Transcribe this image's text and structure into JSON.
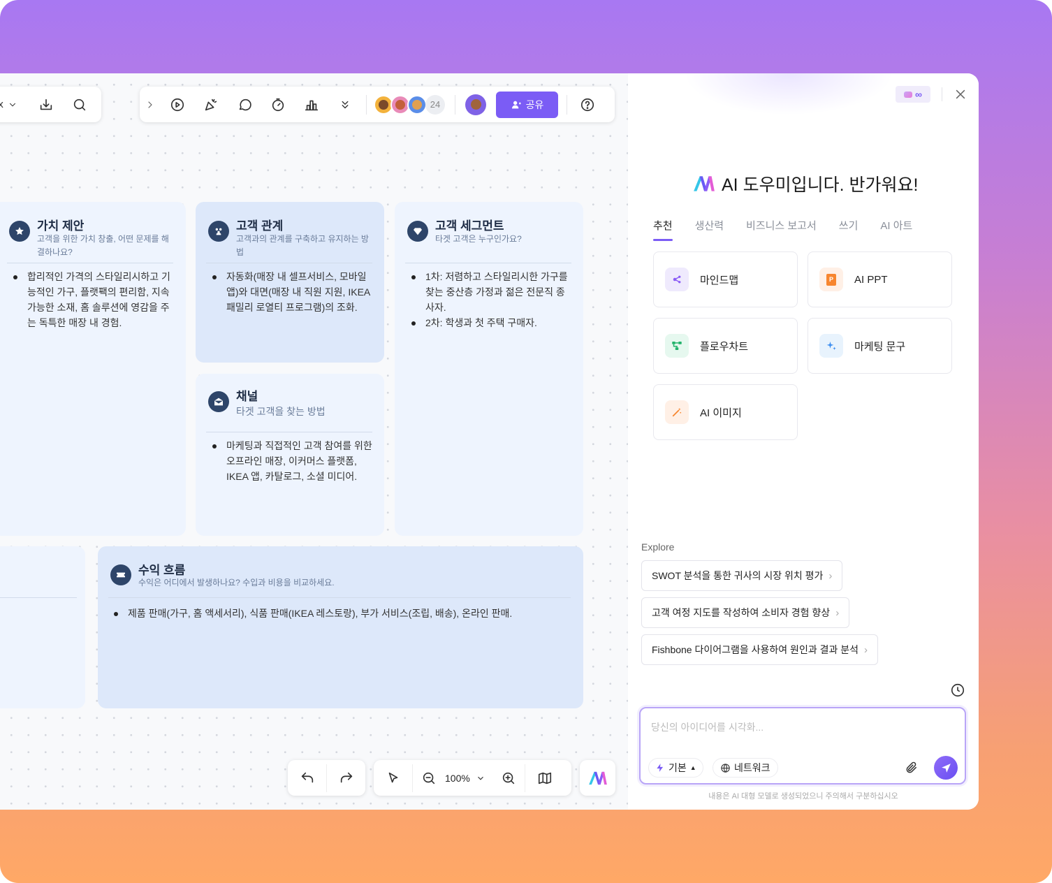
{
  "toolbar": {
    "zoom_label": "100%",
    "share_label": "공유",
    "collaborator_count": "24",
    "x_partial": "x"
  },
  "cards": {
    "value": {
      "title": "가치 제안",
      "sub": "고객을 위한 가치 창출, 어떤 문제를 해결하나요?",
      "items": [
        "합리적인 가격의 스타일리시하고 기능적인 가구, 플랫팩의 편리함, 지속 가능한 소재, 홈 솔루션에 영감을 주는 독특한 매장 내 경험."
      ]
    },
    "relation": {
      "title": "고객 관계",
      "sub": "고객과의 관계를 구축하고 유지하는 방법",
      "items": [
        "자동화(매장 내 셀프서비스, 모바일 앱)와 대면(매장 내 직원 지원, IKEA 패밀리 로열티 프로그램)의 조화."
      ]
    },
    "segment": {
      "title": "고객 세그먼트",
      "sub": "타겟 고객은 누구인가요?",
      "items": [
        "1차: 저렴하고 스타일리시한 가구를 찾는 중산층 가정과 젊은 전문직 종사자.",
        "2차: 학생과 첫 주택 구매자."
      ]
    },
    "channel": {
      "title": "채널",
      "sub": "타겟 고객을 찾는 방법",
      "items": [
        "마케팅과 직접적인 고객 참여를 위한 오프라인 매장, 이커머스 플랫폼, IKEA 앱, 카탈로그, 소셜 미디어."
      ]
    },
    "revenue": {
      "title": "수익 흐름",
      "sub": "수익은 어디에서 발생하나요? 수입과 비용을 비교하세요.",
      "items": [
        "제품 판매(가구, 홈 액세서리), 식품 판매(IKEA 레스토랑), 부가 서비스(조립, 배송), 온라인 판매."
      ]
    }
  },
  "panel": {
    "greeting": "AI 도우미입니다. 반가워요!",
    "tabs": [
      "추천",
      "생산력",
      "비즈니스 보고서",
      "쓰기",
      "AI 아트"
    ],
    "features": [
      "마인드맵",
      "AI PPT",
      "플로우차트",
      "마케팅 문구",
      "AI 이미지"
    ],
    "explore_label": "Explore",
    "explore": [
      "SWOT 분석을 통한 귀사의 시장 위치 평가",
      "고객 여정 지도를 작성하여 소비자 경험 향상",
      "Fishbone 다이어그램을 사용하여 원인과 결과 분석"
    ],
    "input_placeholder": "당신의 아이디어를 시각화...",
    "mode_label": "기본",
    "network_label": "네트워크",
    "disclaimer": "내용은 AI 대형 모델로 생성되었으니 주의해서 구분하십시오"
  },
  "colors": {
    "accent": "#7b5cf5",
    "card_bg": "#eef4fe",
    "card_selected": "#dde8fa",
    "icon_dark": "#2e4569"
  }
}
